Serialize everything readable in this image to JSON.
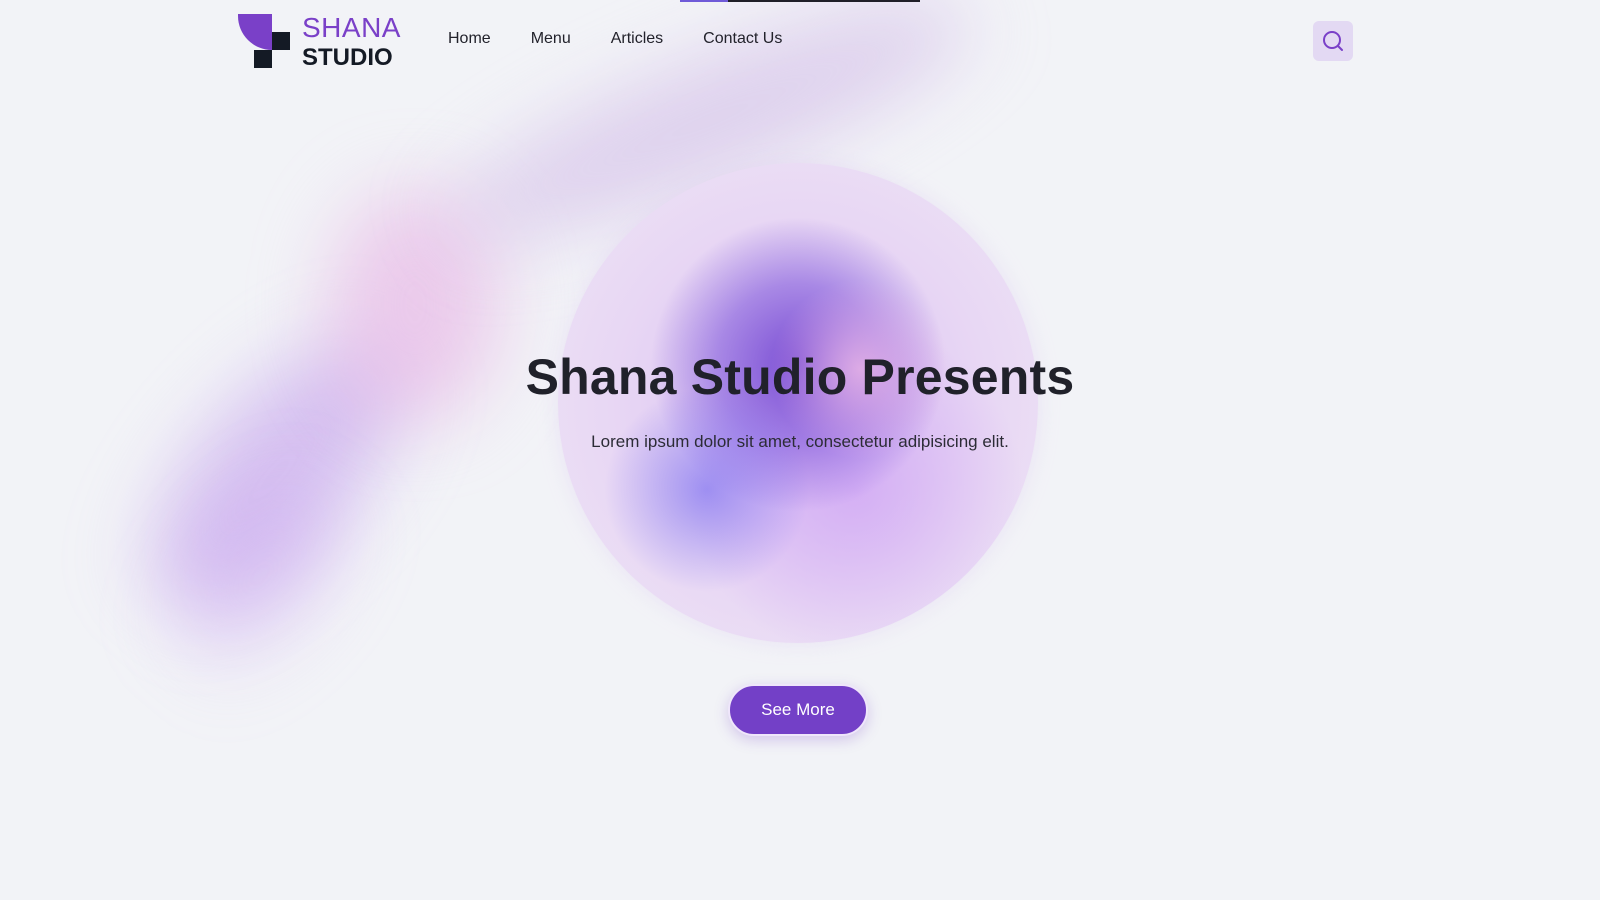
{
  "brand": {
    "name_line1": "SHANA",
    "name_line2": "STUDIO",
    "accent_color": "#7a40c8",
    "dark_color": "#141a25"
  },
  "nav": {
    "items": [
      {
        "label": "Home"
      },
      {
        "label": "Menu"
      },
      {
        "label": "Articles"
      },
      {
        "label": "Contact Us"
      }
    ],
    "search_icon": "search-icon"
  },
  "hero": {
    "title": "Shana Studio Presents",
    "subtitle": "Lorem ipsum dolor sit amet, consectetur adipisicing elit.",
    "cta_label": "See More",
    "cta_color": "#7340c7"
  },
  "page": {
    "background": "#f2f3f7"
  }
}
